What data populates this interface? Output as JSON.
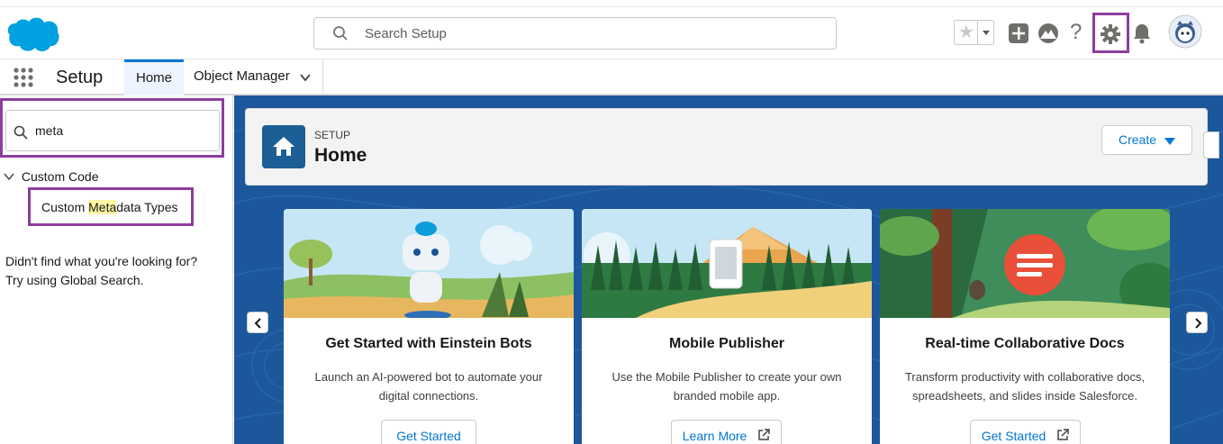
{
  "colors": {
    "brand": "#00a1e0",
    "accent": "#0176d3",
    "highlight_box": "#8e3c9e",
    "page_bg": "#1b5297"
  },
  "header": {
    "search_placeholder": "Search Setup",
    "icons": [
      "salesforce-cloud-logo",
      "search-icon",
      "favorites-star-icon",
      "favorites-dropdown-icon",
      "global-actions-plus-icon",
      "trailhead-icon",
      "help-icon",
      "setup-gear-icon",
      "notification-bell-icon",
      "user-avatar"
    ]
  },
  "nav": {
    "app_title": "Setup",
    "tabs": [
      {
        "label": "Home"
      },
      {
        "label": "Object Manager"
      }
    ]
  },
  "sidebar": {
    "quick_find_value": "meta",
    "tree": {
      "group_label": "Custom Code",
      "item_prefix": "Custom ",
      "item_match": "Meta",
      "item_suffix": "data Types"
    },
    "not_found_line1": "Didn't find what you're looking for?",
    "not_found_line2": "Try using Global Search."
  },
  "page_header": {
    "eyebrow": "SETUP",
    "title": "Home",
    "create_label": "Create"
  },
  "cards": [
    {
      "title": "Get Started with Einstein Bots",
      "desc_line1": "Launch an AI-powered bot to automate your",
      "desc_line2": "digital connections.",
      "button": "Get Started"
    },
    {
      "title": "Mobile Publisher",
      "desc_line1": "Use the Mobile Publisher to create your own",
      "desc_line2": "branded mobile app.",
      "button": "Learn More"
    },
    {
      "title": "Real-time Collaborative Docs",
      "desc_line1": "Transform productivity with collaborative docs,",
      "desc_line2": "spreadsheets, and slides inside Salesforce.",
      "button": "Get Started"
    }
  ]
}
